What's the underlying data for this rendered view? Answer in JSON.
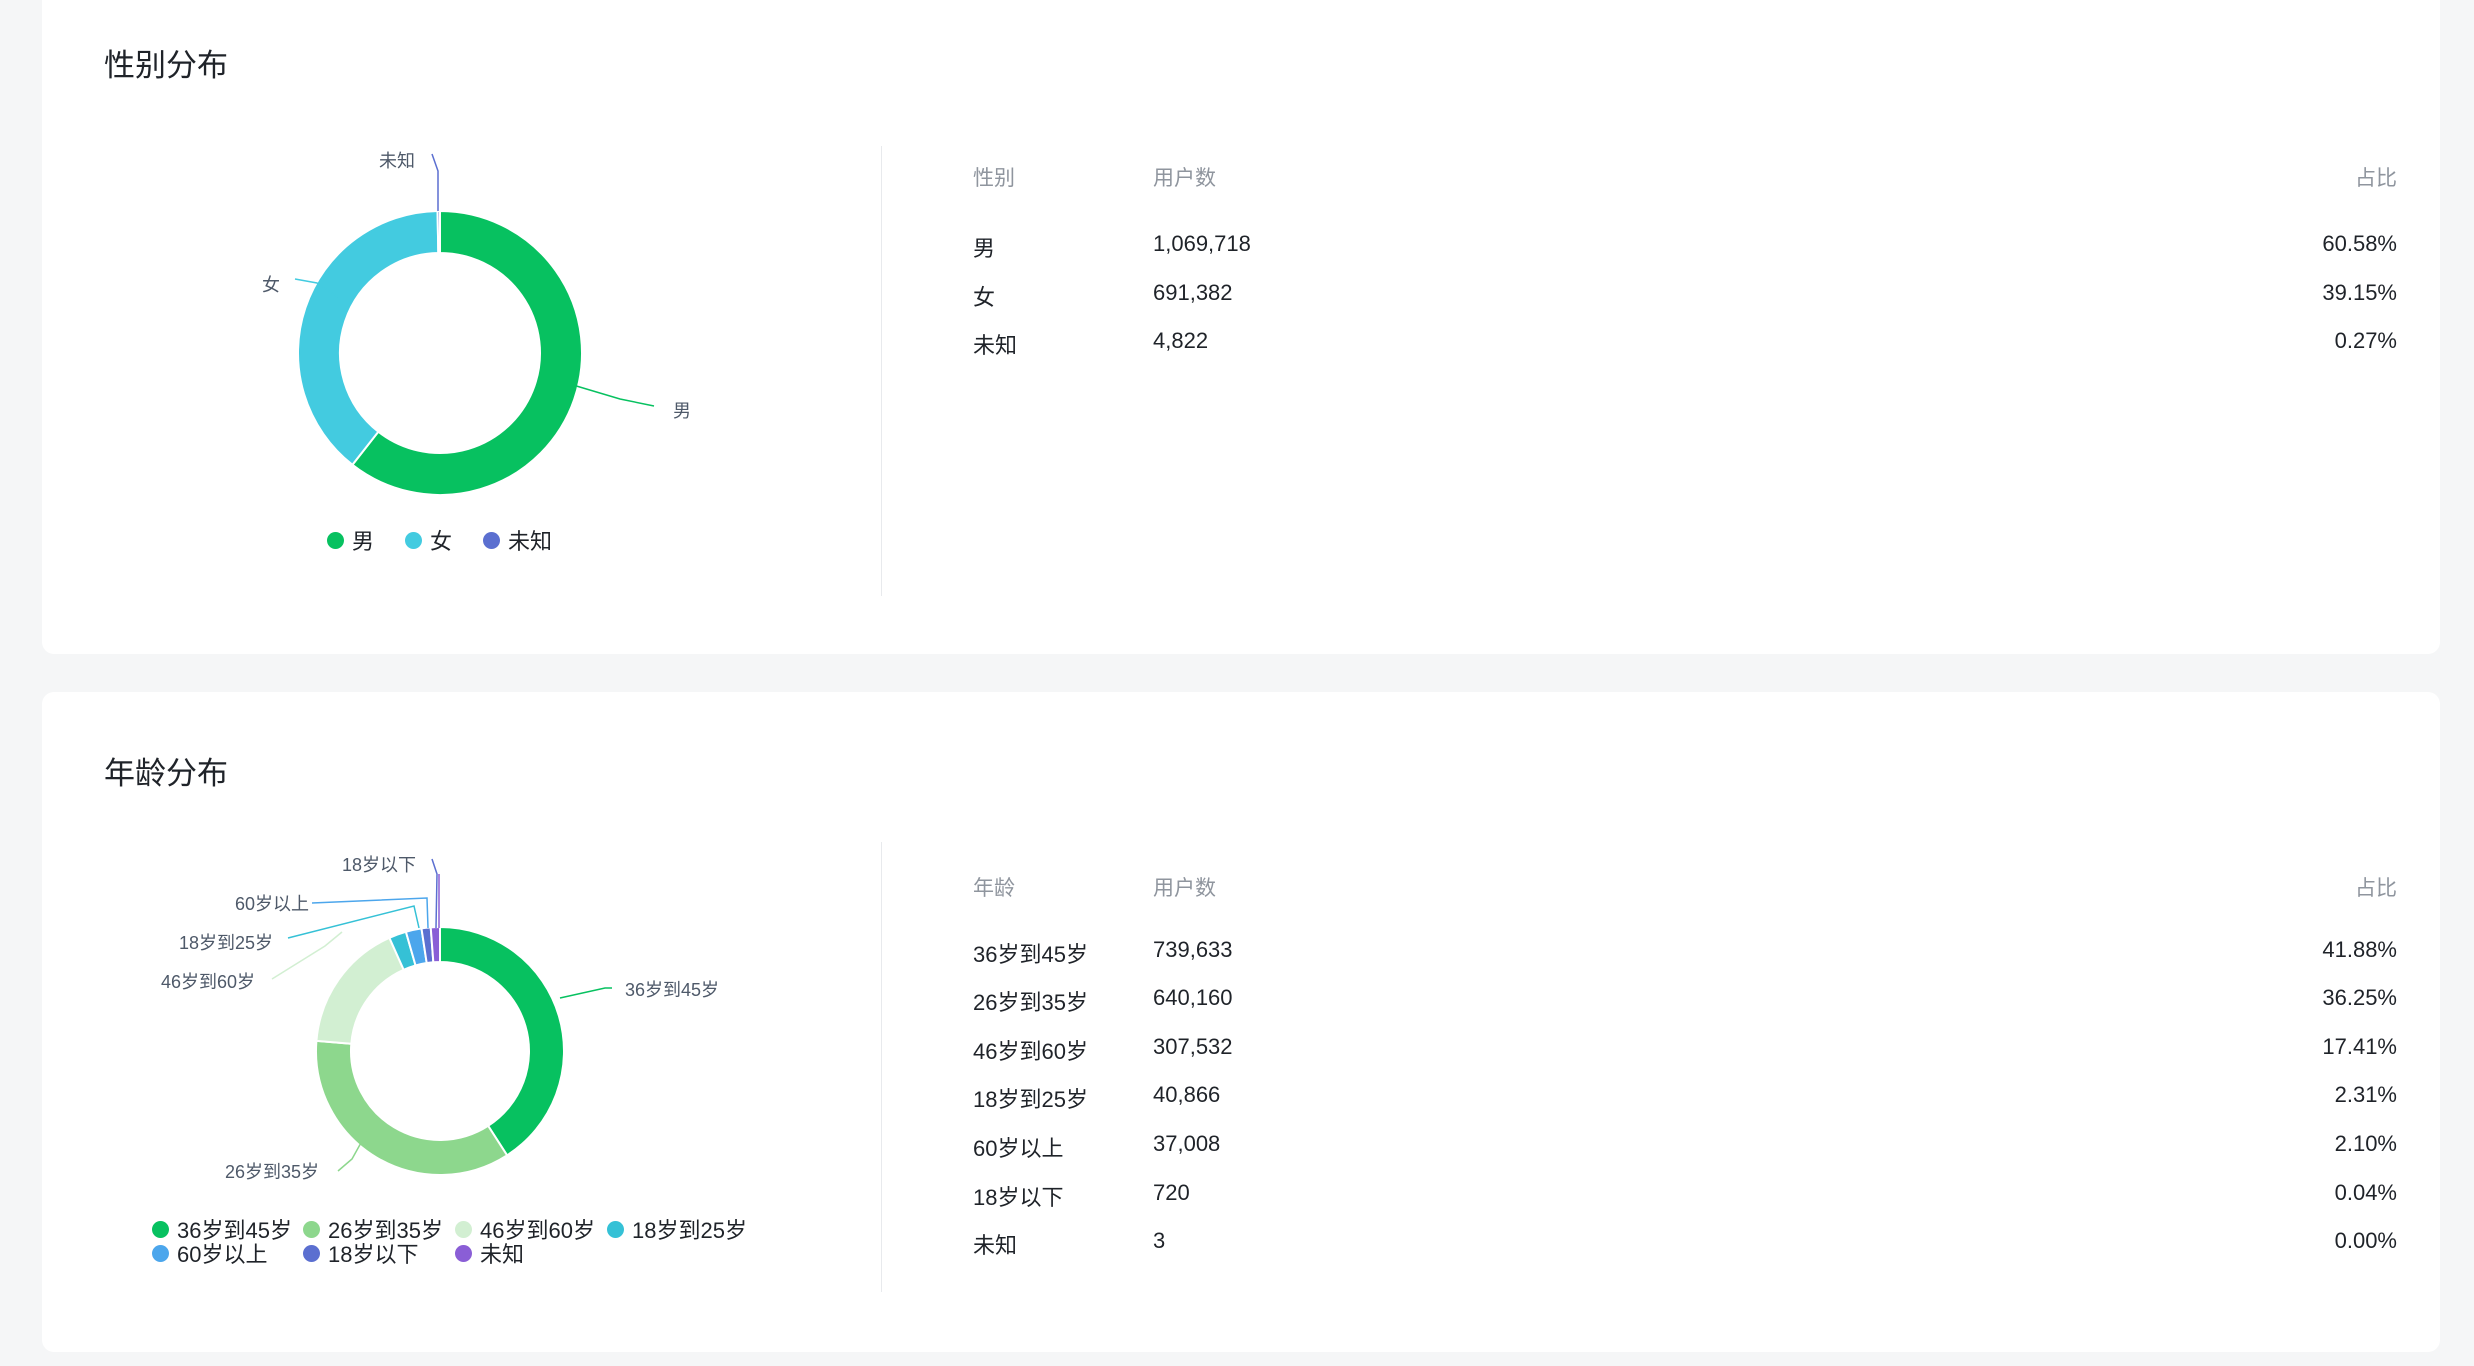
{
  "gender": {
    "title": "性别分布",
    "headers": [
      "性别",
      "用户数",
      "占比"
    ],
    "rows": [
      {
        "label": "男",
        "count": "1,069,718",
        "pct": "60.58%"
      },
      {
        "label": "女",
        "count": "691,382",
        "pct": "39.15%"
      },
      {
        "label": "未知",
        "count": "4,822",
        "pct": "0.27%"
      }
    ]
  },
  "age": {
    "title": "年龄分布",
    "headers": [
      "年龄",
      "用户数",
      "占比"
    ],
    "rows": [
      {
        "label": "36岁到45岁",
        "count": "739,633",
        "pct": "41.88%"
      },
      {
        "label": "26岁到35岁",
        "count": "640,160",
        "pct": "36.25%"
      },
      {
        "label": "46岁到60岁",
        "count": "307,532",
        "pct": "17.41%"
      },
      {
        "label": "18岁到25岁",
        "count": "40,866",
        "pct": "2.31%"
      },
      {
        "label": "60岁以上",
        "count": "37,008",
        "pct": "2.10%"
      },
      {
        "label": "18岁以下",
        "count": "720",
        "pct": "0.04%"
      },
      {
        "label": "未知",
        "count": "3",
        "pct": "0.00%"
      }
    ]
  },
  "chart_data": [
    {
      "type": "pie",
      "variant": "donut",
      "categories": [
        "男",
        "女",
        "未知"
      ],
      "values": [
        1069718,
        691382,
        4822
      ],
      "colors": [
        "#07c160",
        "#43cbe0",
        "#5b6fd0"
      ],
      "legend_position": "bottom"
    },
    {
      "type": "pie",
      "variant": "donut",
      "categories": [
        "36岁到45岁",
        "26岁到35岁",
        "46岁到60岁",
        "18岁到25岁",
        "60岁以上",
        "18岁以下",
        "未知"
      ],
      "values": [
        739633,
        640160,
        307532,
        40866,
        37008,
        720,
        3
      ],
      "colors": [
        "#07c160",
        "#8dd78d",
        "#d2efd2",
        "#35c1d6",
        "#4ca6ec",
        "#5b6fd0",
        "#8a5ed6"
      ],
      "legend_position": "bottom"
    }
  ]
}
